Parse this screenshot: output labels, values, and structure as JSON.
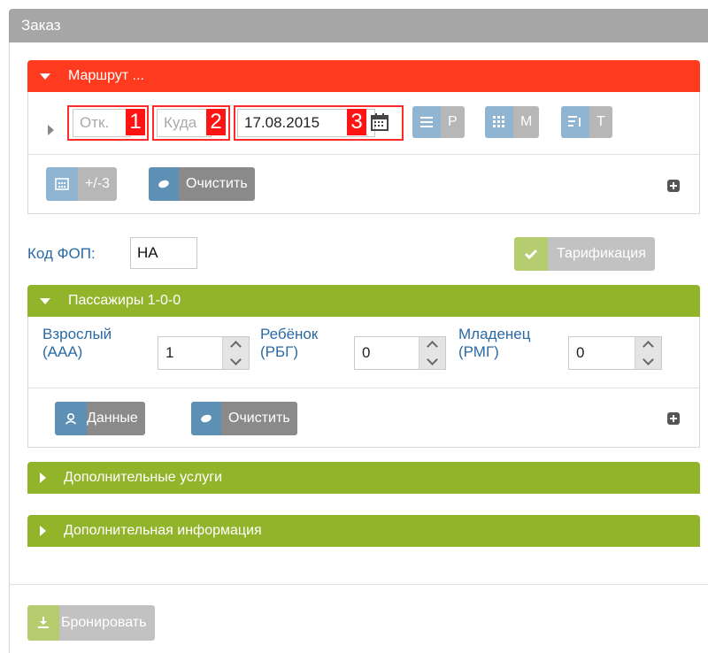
{
  "panel": {
    "title": "Заказ"
  },
  "route": {
    "title": "Маршрут ...",
    "from": {
      "placeholder": "Отк.",
      "badge": "1"
    },
    "to": {
      "placeholder": "Куда",
      "badge": "2"
    },
    "date": {
      "value": "17.08.2015",
      "badge": "3"
    },
    "type_buttons": [
      {
        "icon": "list-icon",
        "label": "Р"
      },
      {
        "icon": "grid-icon",
        "label": "М"
      },
      {
        "icon": "sort-icon",
        "label": "Т"
      }
    ],
    "range_button": {
      "label": "+/-3"
    },
    "clear_button": {
      "label": "Очистить"
    }
  },
  "fop": {
    "label": "Код ФОП:",
    "value": "НА"
  },
  "tariff_button": {
    "label": "Тарификация"
  },
  "passengers": {
    "title": "Пассажиры 1-0-0",
    "adult": {
      "label_line1": "Взрослый",
      "label_line2": "(ААА)",
      "value": "1"
    },
    "child": {
      "label_line1": "Ребёнок",
      "label_line2": "(РБГ)",
      "value": "0"
    },
    "infant": {
      "label_line1": "Младенец",
      "label_line2": "(РМГ)",
      "value": "0"
    },
    "data_button": {
      "label": "Данные"
    },
    "clear_button": {
      "label": "Очистить"
    }
  },
  "extra_services": {
    "title": "Дополнительные услуги"
  },
  "extra_info": {
    "title": "Дополнительная информация"
  },
  "book_button": {
    "label": "Бронировать"
  },
  "colors": {
    "route": "#ff3b1f",
    "section": "#92b42b",
    "header": "#a6a6a6"
  }
}
